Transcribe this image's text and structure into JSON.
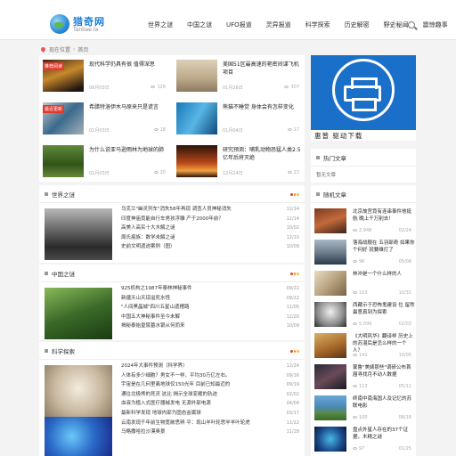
{
  "site": {
    "name": "猎奇网",
    "domain": "Tanliee.la"
  },
  "nav": [
    "世界之谜",
    "中国之谜",
    "UFO报道",
    "灵异报道",
    "科学探索",
    "历史解密",
    "野史秘闻",
    "震惊趣事"
  ],
  "breadcrumb": {
    "label": "现在位置",
    "current": "首页"
  },
  "top_grid": [
    {
      "title": "现代科学仍具有很 值得深思",
      "date": "06月03日",
      "views": "126",
      "badge": "推荐阅读"
    },
    {
      "title": "美国51区最高速的艳密间谍飞机 项目",
      "date": "01月26日",
      "views": "307",
      "badge": ""
    },
    {
      "title": "希腊特洛伊木马原来只是谎言",
      "date": "01月03日",
      "views": "18",
      "badge": "最近更新"
    },
    {
      "title": "熊猫不睡觉 身体会有怎样变化",
      "date": "01月04日",
      "views": "17",
      "badge": ""
    },
    {
      "title": "为什么说亚马逊雨林为地球的肺",
      "date": "01月03日",
      "views": "20",
      "badge": ""
    },
    {
      "title": "研究预测：哺乳动物恐猛人类2.5亿年后将灭绝",
      "date": "12月24日",
      "views": "23",
      "badge": ""
    }
  ],
  "ad": {
    "caption": "惠普  驱动下载",
    "color": "#1a6fc8"
  },
  "hot": {
    "title": "热门文章",
    "empty": "暂无文章"
  },
  "random": {
    "title": "随机文章",
    "items": [
      {
        "title": "北京故宫竟有连串事件他挺航 晚上千万别去！",
        "views": "2,948",
        "date": "02/24"
      },
      {
        "title": "落海战舰在 五羽部奇 如果你个何好 就要维打了",
        "views": "96",
        "date": "05/08"
      },
      {
        "title": "林冲是一个什么样的人",
        "views": "103",
        "date": "10/31"
      },
      {
        "title": "西藏示于恐怖鬼建设 位 留然最意真到为探索",
        "views": "5,099",
        "date": "02/03"
      },
      {
        "title": "《大明风华》翻译样 历史上的苏湛后是怎么样的一个人？",
        "views": "141",
        "date": "10/05"
      },
      {
        "title": "蒙鲁\"美婊那些\"调研公布首届寻找月不动人数据",
        "views": "113",
        "date": "05/11"
      },
      {
        "title": "终南中南海国人及记忆的苏联电影",
        "views": "100",
        "date": "08/18"
      },
      {
        "title": "盘点外星人存在的37个证据，木精之谜",
        "views": "97",
        "date": "01/25"
      }
    ]
  },
  "sections": [
    {
      "title": "世界之谜",
      "items": [
        {
          "text": "乌克兰\"幽灵列车\"消失58年再现 调查人员神秘消失",
          "date": "12/14"
        },
        {
          "text": "印度神庙竟能自行车男孩浮雕 产于2000年前？",
          "date": "12/14"
        },
        {
          "text": "高美人高实十大木解之谜",
          "date": "10/02"
        },
        {
          "text": "周氏痕族：数学未解之谜",
          "date": "12/10"
        },
        {
          "text": "史前文明遗迹案例（图）",
          "date": "10/09"
        }
      ]
    },
    {
      "title": "中国之谜",
      "items": [
        {
          "text": "925机构之1987年泰林神秘事件",
          "date": "09/22"
        },
        {
          "text": "新疆天山天琼溢死水怪",
          "date": "09/22"
        },
        {
          "text": "\"人间黑晶城\"四川五星山遗槽路",
          "date": "11/05"
        },
        {
          "text": "中国五大神秘事件至今未解",
          "date": "12/20"
        },
        {
          "text": "揭秘泰始皇陵墓水银从何而来",
          "date": "10/09"
        }
      ]
    },
    {
      "title": "科学探索",
      "items": [
        {
          "text": "2024年大事件预测（科学界）",
          "date": "12/24"
        },
        {
          "text": "人体有多少细胞？男女不一样，平均30万亿左右。",
          "date": "09/16"
        },
        {
          "text": "宇宙是在几何里离地球仅150光年 目前已知最近的",
          "date": "09/19"
        },
        {
          "text": "通往北极熊的死灵 这比 揭示全球变暖的轨迹",
          "date": "02/02"
        },
        {
          "text": "血液为植入式医疗器械发电 无源外部电源",
          "date": "04/04"
        },
        {
          "text": "最新科学发现 地球内部为固态金属球",
          "date": "03/17"
        },
        {
          "text": "云南发现千年前生物宽敞思辨 平：现山羊叶轮思羊羊叶轮虎",
          "date": "11/22"
        },
        {
          "text": "马略撒哈拉沙漠奥景",
          "date": "11/28"
        }
      ]
    }
  ]
}
